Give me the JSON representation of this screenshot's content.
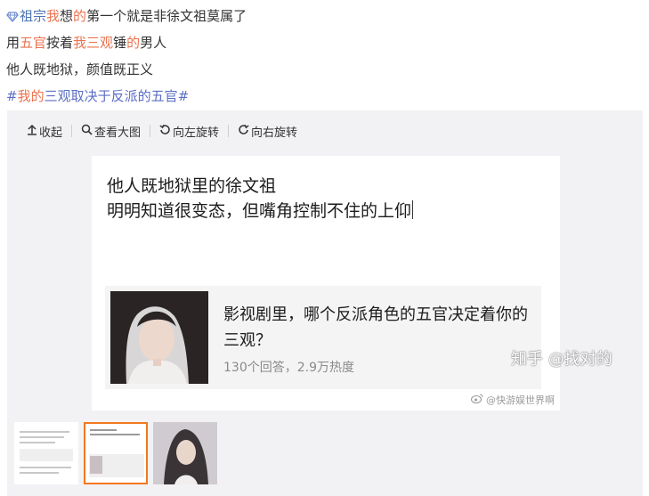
{
  "post": {
    "line1": {
      "t1": "祖宗",
      "t2": "我",
      "t3": "想",
      "t4": "的",
      "t5": "第一个就是非徐文祖莫属了"
    },
    "line2": {
      "t1": "用",
      "t2": "五官",
      "t3": "按着",
      "t4": "我三观",
      "t5": "锤",
      "t6": "的",
      "t7": "男人"
    },
    "line3": "他人既地狱，颜值既正义",
    "line4": {
      "t1": "#",
      "t2": "我的",
      "t3": "三观取决于反派的五官",
      "t4": "#"
    }
  },
  "toolbar": {
    "collapse": "收起",
    "view_large": "查看大图",
    "rotate_left": "向左旋转",
    "rotate_right": "向右旋转"
  },
  "image": {
    "quote_line1": "他人既地狱里的徐文祖",
    "quote_line2": "明明知道很变态，但嘴角控制不住的上仰",
    "card_title": "影视剧里，哪个反派角色的五官决定着你的三观？",
    "card_meta": "130个回答，2.9万热度",
    "watermark": "@快游娱世界啊"
  },
  "overlay_watermark": "知乎 @找对的",
  "colors": {
    "highlight": "#eb7350",
    "hashtag": "#5b6ec7",
    "active_thumb_border": "#f2781f",
    "viewer_bg": "#f2f2f5"
  }
}
